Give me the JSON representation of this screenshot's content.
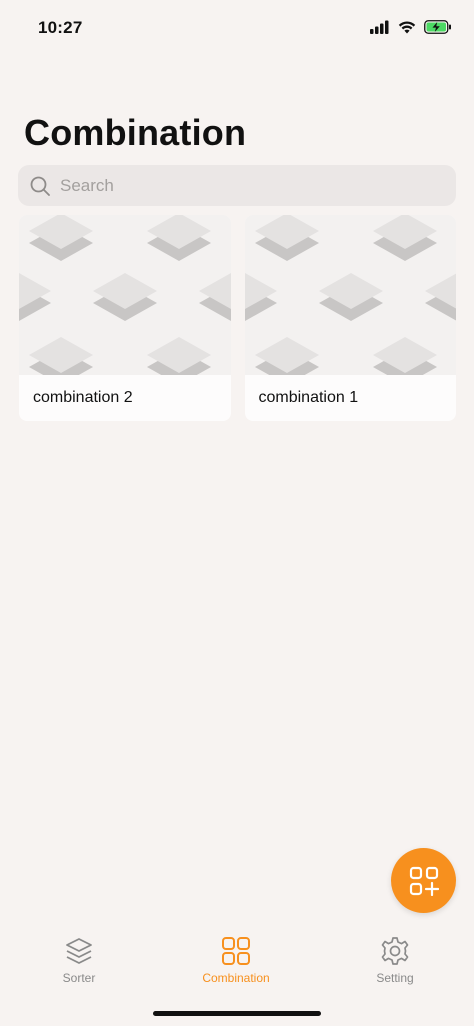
{
  "status_bar": {
    "time": "10:27"
  },
  "header": {
    "title": "Combination"
  },
  "search": {
    "placeholder": "Search",
    "icon": "search-icon"
  },
  "combinations": [
    {
      "name": "combination 2"
    },
    {
      "name": "combination 1"
    }
  ],
  "fab": {
    "icon": "add-combination-icon"
  },
  "tabbar": {
    "active": "Combination",
    "tabs": [
      {
        "label": "Sorter",
        "icon": "layers-icon"
      },
      {
        "label": "Combination",
        "icon": "grid-icon"
      },
      {
        "label": "Setting",
        "icon": "gear-icon"
      }
    ]
  },
  "colors": {
    "accent": "#f7901e",
    "background": "#f7f3f1",
    "inactive": "#8a8a8a"
  }
}
